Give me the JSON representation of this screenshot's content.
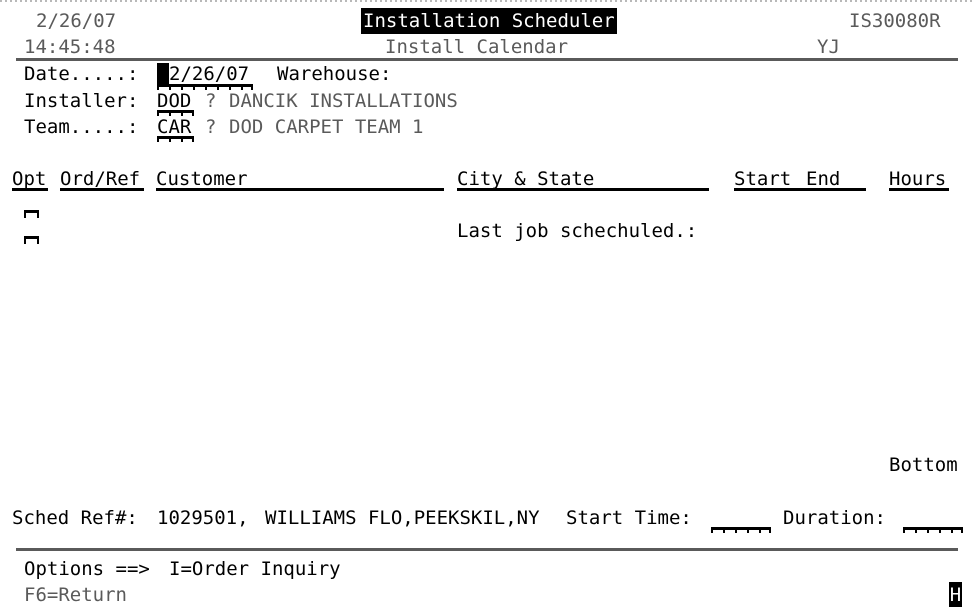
{
  "screen": {
    "program_id": "IS30080R",
    "user_code": "YJ",
    "date": "2/26/07",
    "time": "14:45:48",
    "title": "Installation Scheduler",
    "subtitle": "Install Calendar"
  },
  "colors": {
    "background": "#ffffff",
    "text": "#000000",
    "dim_text": "#5a5a5a",
    "reverse_bg": "#000000",
    "reverse_fg": "#ffffff",
    "rule": "#5a5a5a"
  },
  "prompts": {
    "date_label": "Date.....:",
    "date_value": "2/26/07",
    "warehouse_label": "Warehouse:",
    "warehouse_value": "",
    "installer_label": "Installer:",
    "installer_value": "DOD",
    "installer_help": "?",
    "installer_desc": "DANCIK INSTALLATIONS",
    "team_label": "Team.....:",
    "team_value": "CAR",
    "team_help": "?",
    "team_desc": "DOD CARPET TEAM 1"
  },
  "columns": [
    {
      "label": "Opt"
    },
    {
      "label": "Ord/Ref"
    },
    {
      "label": "Customer"
    },
    {
      "label": "City & State"
    },
    {
      "label": "Start"
    },
    {
      "label": "End"
    },
    {
      "label": "Hours"
    }
  ],
  "list": {
    "rows": [],
    "message": "Last job schechuled.:",
    "position_indicator": "Bottom"
  },
  "detail": {
    "sched_ref_label": "Sched Ref#:",
    "sched_ref_value": "1029501,",
    "customer": "WILLIAMS FLO,PEEKSKIL,NY",
    "start_time_label": "Start Time:",
    "start_time_value": "",
    "duration_label": "Duration:",
    "duration_value": ""
  },
  "footer": {
    "options_label": "Options ==>",
    "options_text": "I=Order Inquiry",
    "function_keys": "F6=Return",
    "status_indicator": "H"
  }
}
